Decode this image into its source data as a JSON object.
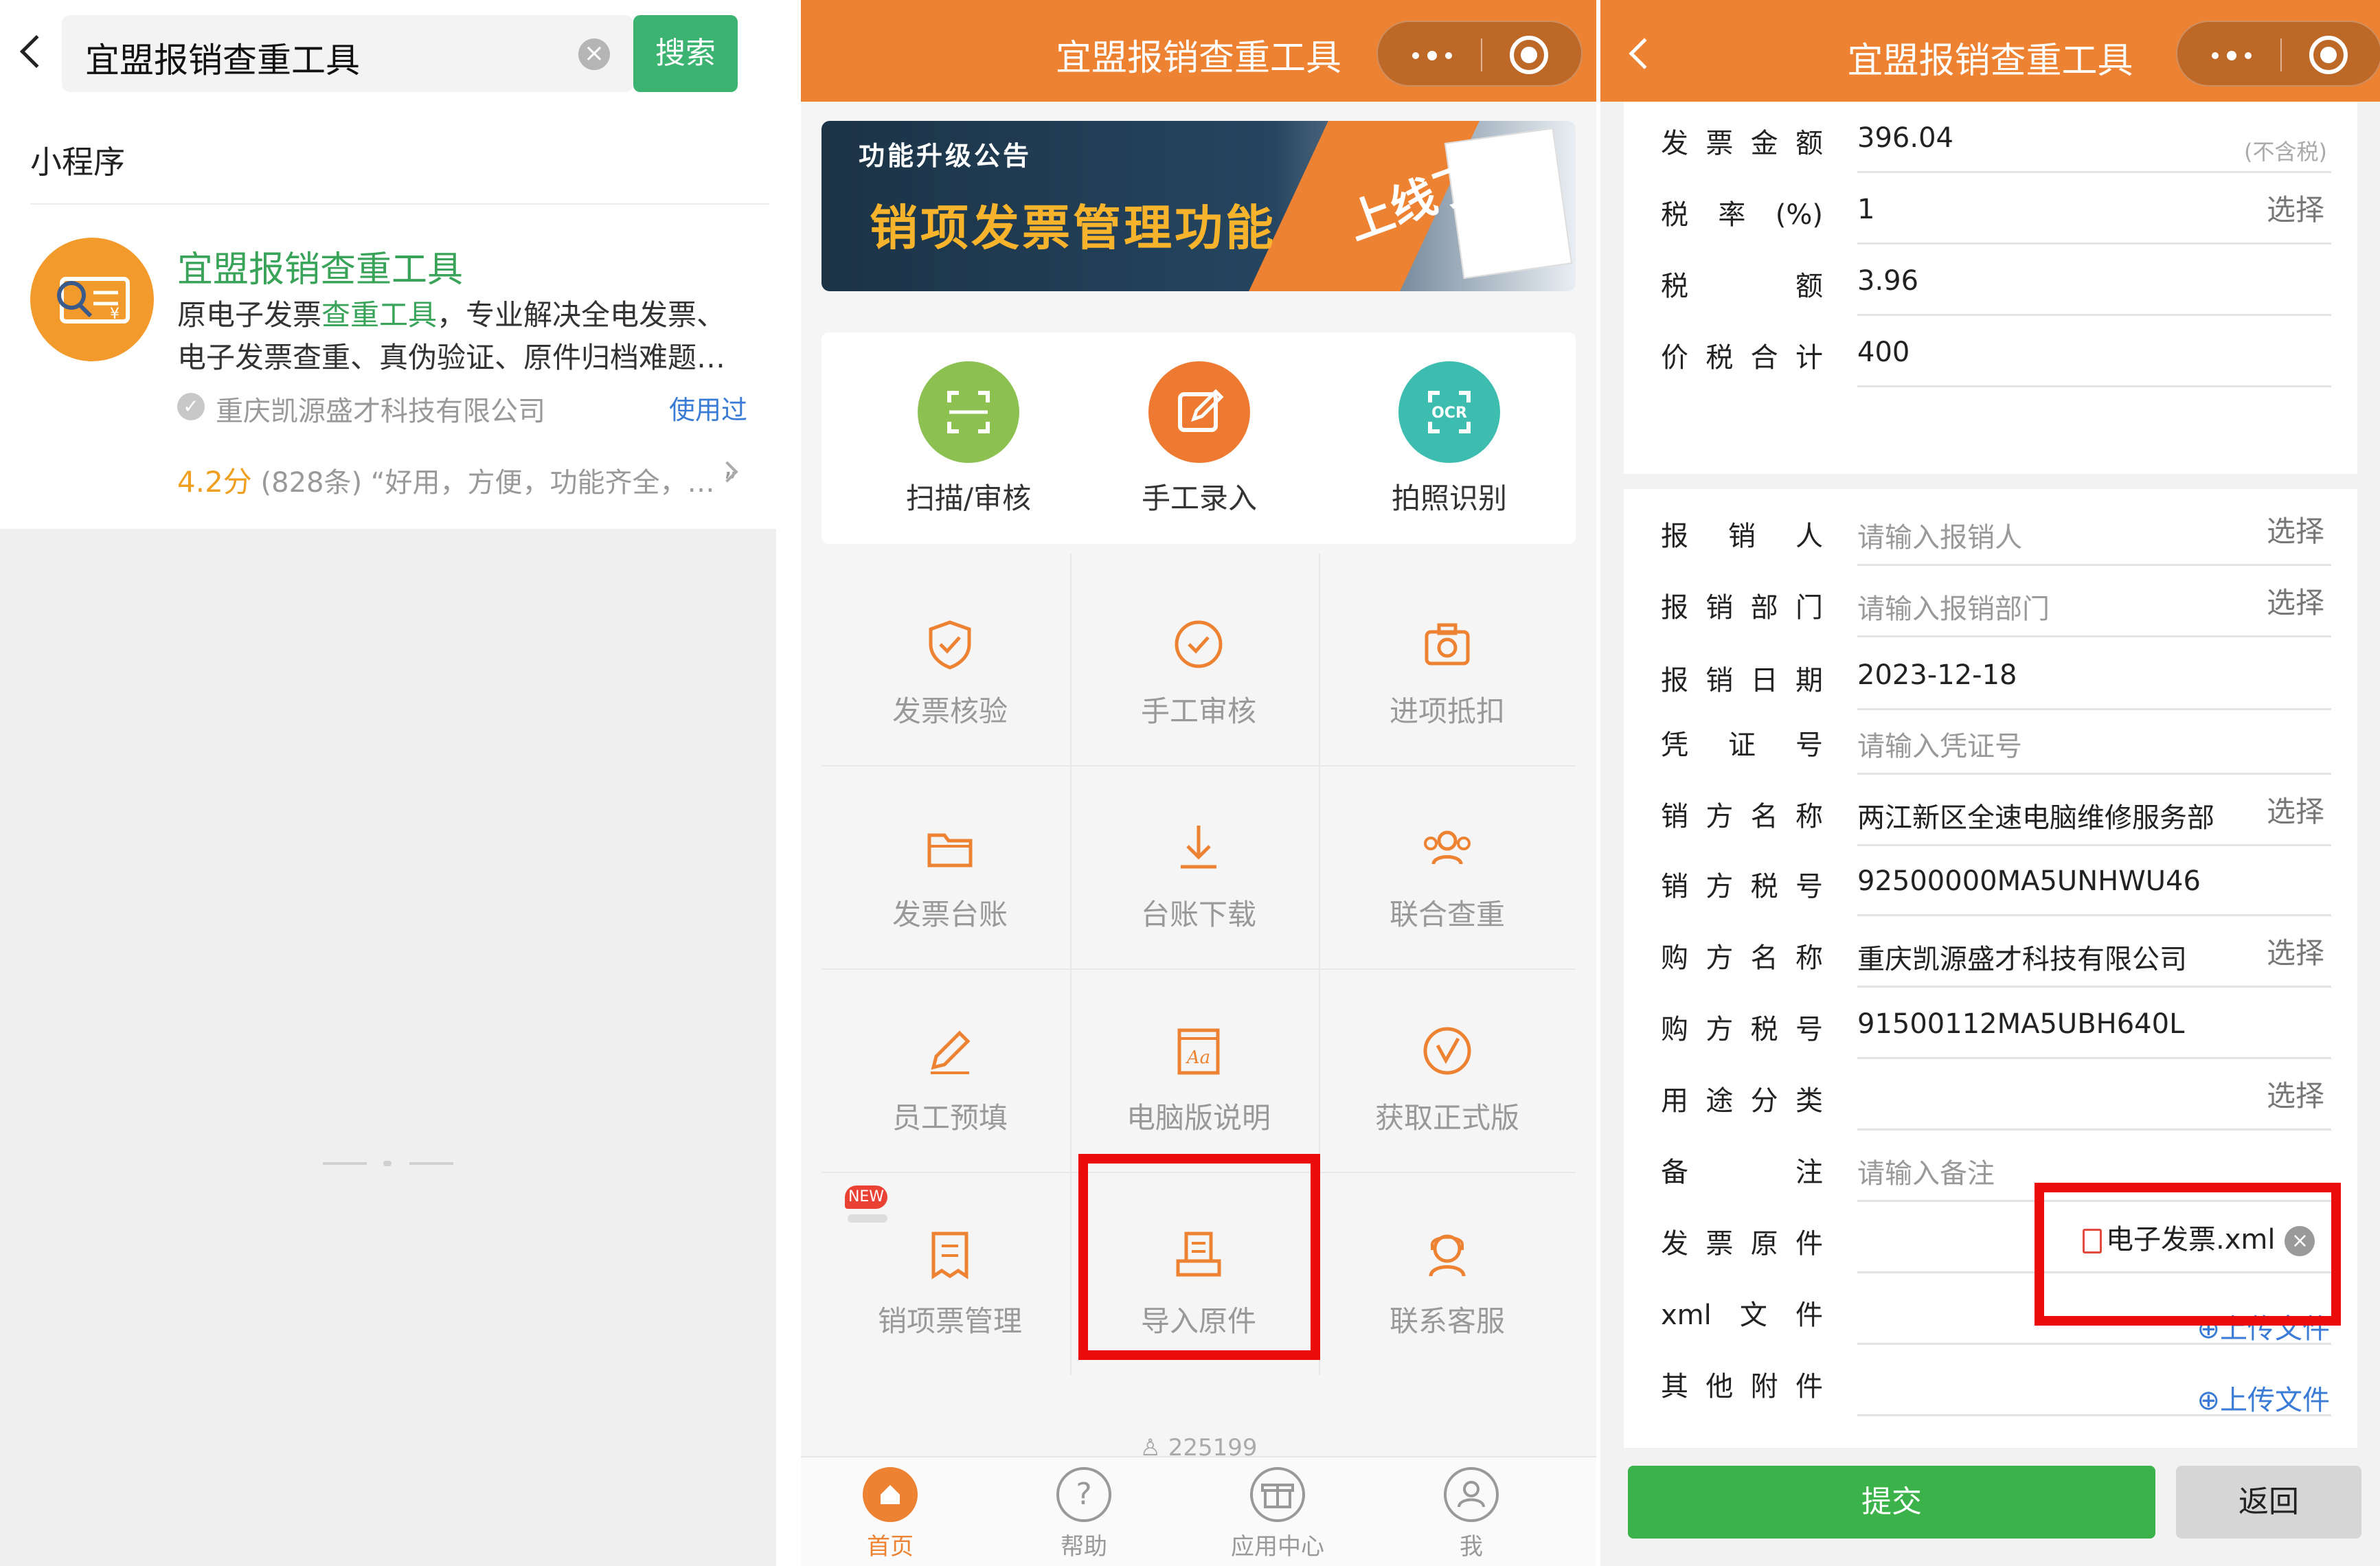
{
  "search_page": {
    "query": "宜盟报销查重工具",
    "search_button": "搜索",
    "section_title": "小程序",
    "result": {
      "name": "宜盟报销查重工具",
      "desc_prefix": "原电子发票",
      "desc_highlight": "查重工具",
      "desc_suffix": "，专业解决全电发票、电子发票查重、真伪验证、原件归档难题…",
      "company": "重庆凯源盛才科技有限公司",
      "used_badge": "使用过",
      "rating": "4.2分",
      "rating_rest": "(828条) “好用，方便，功能齐全，… ”"
    }
  },
  "home_page": {
    "title": "宜盟报销查重工具",
    "banner": {
      "subtitle": "功能升级公告",
      "main": "销项发票管理功能",
      "live": "上线了!"
    },
    "quick_actions": [
      {
        "label": "扫描/审核",
        "color": "#8cc152",
        "icon": "scan-icon"
      },
      {
        "label": "手工录入",
        "color": "#ee7a32",
        "icon": "edit-icon"
      },
      {
        "label": "拍照识别",
        "color": "#3dbdb0",
        "icon": "ocr-icon"
      }
    ],
    "grid": [
      {
        "label": "发票核验",
        "icon": "shield-check-icon"
      },
      {
        "label": "手工审核",
        "icon": "check-circle-icon"
      },
      {
        "label": "进项抵扣",
        "icon": "camera-icon"
      },
      {
        "label": "发票台账",
        "icon": "folder-icon"
      },
      {
        "label": "台账下载",
        "icon": "download-icon"
      },
      {
        "label": "联合查重",
        "icon": "users-icon"
      },
      {
        "label": "员工预填",
        "icon": "pencil-icon"
      },
      {
        "label": "电脑版说明",
        "icon": "document-aa-icon"
      },
      {
        "label": "获取正式版",
        "icon": "version-icon"
      },
      {
        "label": "销项票管理",
        "icon": "receipt-icon"
      },
      {
        "label": "导入原件",
        "icon": "import-icon"
      },
      {
        "label": "联系客服",
        "icon": "support-icon"
      }
    ],
    "new_badge": "NEW",
    "user_id": "225199",
    "tabs": [
      {
        "label": "首页",
        "icon": "home-icon",
        "active": true
      },
      {
        "label": "帮助",
        "icon": "help-icon",
        "active": false
      },
      {
        "label": "应用中心",
        "icon": "gift-icon",
        "active": false
      },
      {
        "label": "我",
        "icon": "user-icon",
        "active": false
      }
    ],
    "accent_color": "#ee8233"
  },
  "form_page": {
    "title": "宜盟报销查重工具",
    "top_rows": [
      {
        "label": "发票金额",
        "value": "396.04",
        "note": "(不含税)"
      },
      {
        "label": "税率(%)",
        "value": "1",
        "select": "选择"
      },
      {
        "label": "税额",
        "value": "3.96"
      },
      {
        "label": "价税合计",
        "value": "400"
      }
    ],
    "rows": [
      {
        "label": "报销人",
        "placeholder": "请输入报销人",
        "select": "选择"
      },
      {
        "label": "报销部门",
        "placeholder": "请输入报销部门",
        "select": "选择"
      },
      {
        "label": "报销日期",
        "value": "2023-12-18"
      },
      {
        "label": "凭证号",
        "placeholder": "请输入凭证号"
      },
      {
        "label": "销方名称",
        "value": "两江新区全速电脑维修服务部",
        "select": "选择"
      },
      {
        "label": "销方税号",
        "value": "92500000MA5UNHWU46"
      },
      {
        "label": "购方名称",
        "value": "重庆凯源盛才科技有限公司",
        "select": "选择"
      },
      {
        "label": "购方税号",
        "value": "91500112MA5UBH640L"
      },
      {
        "label": "用途分类",
        "select": "选择"
      },
      {
        "label": "备注",
        "placeholder": "请输入备注"
      },
      {
        "label": "发票原件",
        "file": "电子发票.xml"
      },
      {
        "label": "xml文件",
        "upload": "⊕上传文件"
      },
      {
        "label": "其他附件",
        "upload": "⊕上传文件"
      }
    ],
    "submit": "提交",
    "back": "返回"
  }
}
